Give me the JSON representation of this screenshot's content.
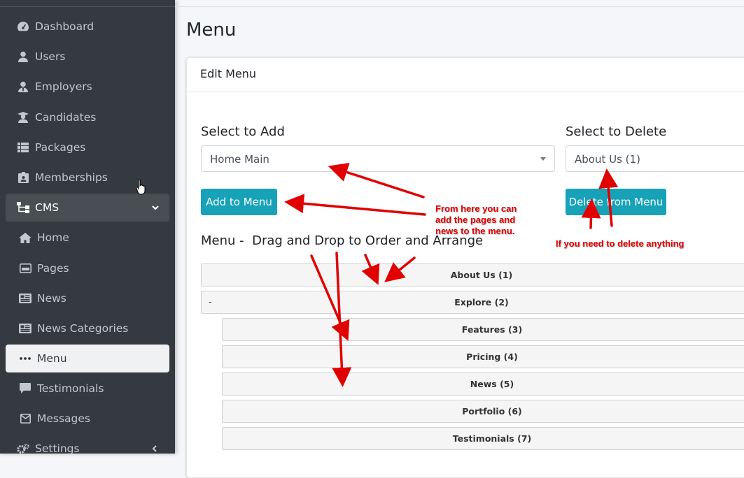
{
  "sidebar": {
    "items": [
      {
        "label": "Dashboard",
        "icon": "dashboard-icon"
      },
      {
        "label": "Users",
        "icon": "user-icon"
      },
      {
        "label": "Employers",
        "icon": "user-tie-icon"
      },
      {
        "label": "Candidates",
        "icon": "graduate-icon"
      },
      {
        "label": "Packages",
        "icon": "table-icon"
      },
      {
        "label": "Memberships",
        "icon": "id-card-icon"
      },
      {
        "label": "CMS",
        "icon": "sitemap-icon"
      },
      {
        "label": "Home",
        "icon": "home-icon"
      },
      {
        "label": "Pages",
        "icon": "pages-icon"
      },
      {
        "label": "News",
        "icon": "news-icon"
      },
      {
        "label": "News Categories",
        "icon": "news-icon"
      },
      {
        "label": "Menu",
        "icon": "ellipsis-icon"
      },
      {
        "label": "Testimonials",
        "icon": "comment-icon"
      },
      {
        "label": "Messages",
        "icon": "envelope-icon"
      },
      {
        "label": "Settings",
        "icon": "cogs-icon"
      }
    ]
  },
  "main": {
    "title": "Menu",
    "card_title": "Edit Menu",
    "add": {
      "label": "Select to Add",
      "selected": "Home Main",
      "button": "Add to Menu"
    },
    "delete": {
      "label": "Select to Delete",
      "selected": "About Us (1)",
      "button": "Delete from Menu"
    },
    "menu_heading": "Menu -  Drag and Drop to Order and Arrange",
    "menu_items": [
      {
        "label": "About Us (1)",
        "level": 0
      },
      {
        "label": "Explore (2)",
        "level": 0,
        "toggle": "-"
      },
      {
        "label": "Features (3)",
        "level": 1
      },
      {
        "label": "Pricing (4)",
        "level": 1
      },
      {
        "label": "News (5)",
        "level": 1
      },
      {
        "label": "Portfolio (6)",
        "level": 1
      },
      {
        "label": "Testimonials (7)",
        "level": 1
      }
    ]
  },
  "annotations": {
    "add_note": [
      "From here you can",
      "add the pages and",
      "news to the menu."
    ],
    "delete_note": "If you need to delete anything"
  },
  "colors": {
    "sidebar": "#343a40",
    "accent": "#17a2b8",
    "annotation": "#e00000"
  }
}
